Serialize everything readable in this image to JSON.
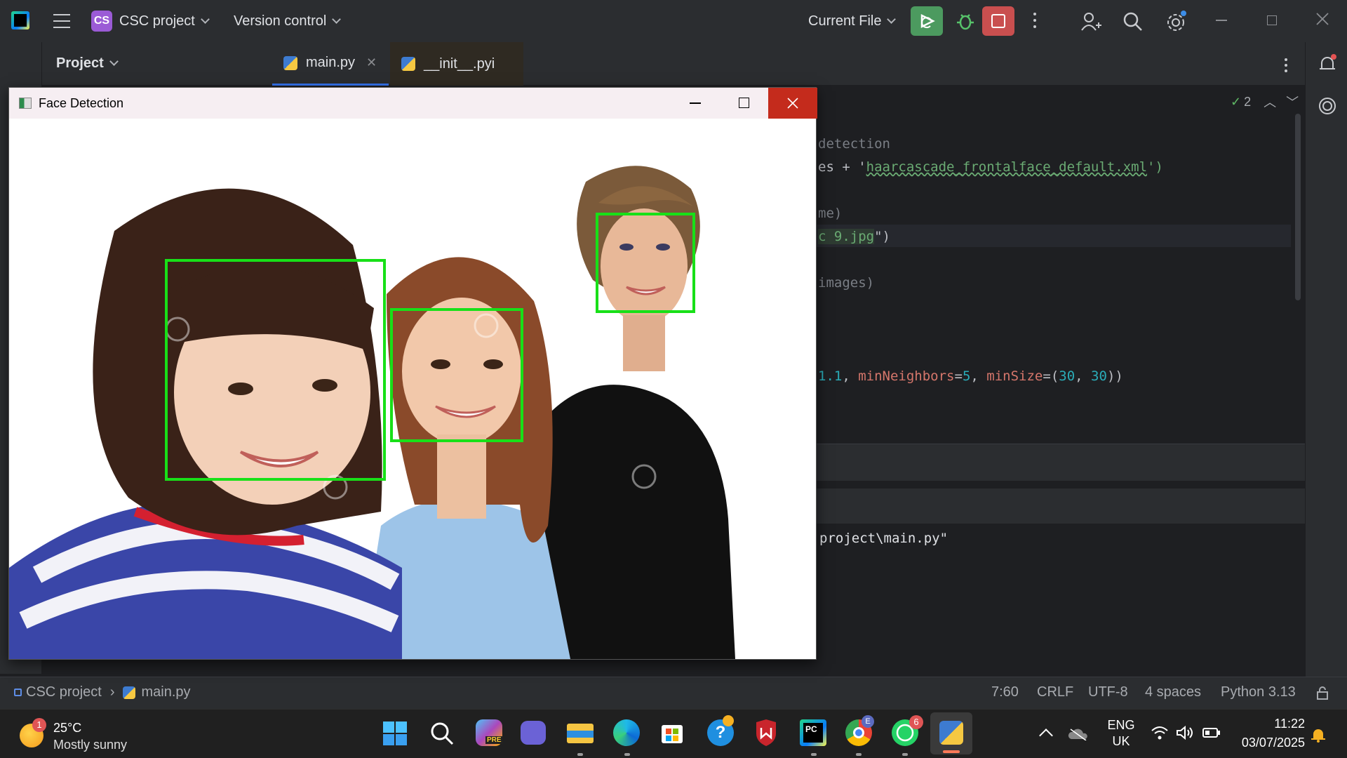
{
  "ide": {
    "project_badge": "CS",
    "project_name": "CSC project",
    "version_control": "Version control",
    "run_config": "Current File",
    "project_panel_label": "Project",
    "tabs": [
      {
        "label": "main.py",
        "closable": true,
        "active": true
      },
      {
        "label": "__init__.pyi",
        "closable": false,
        "active": false
      }
    ],
    "inspection_count": "2",
    "code_lines": [
      {
        "text": "detection",
        "style": "comment"
      },
      {
        "text": "es + 'haarcascade_frontalface_default.xml')",
        "style": "string"
      },
      {
        "text": "me)",
        "style": "comment"
      },
      {
        "text": "c 9.jpg\")",
        "style": "string"
      },
      {
        "text": "images)",
        "style": "comment"
      },
      {
        "text": "1.1, minNeighbors=5, minSize=(30, 30))",
        "style": "params"
      }
    ],
    "code_parts": {
      "line2_pre": "es + '",
      "line2_str": "haarcascade_frontalface_default.xml",
      "line2_post": "')",
      "line4_str": "c 9.jpg",
      "line4_post": "\")",
      "line6_n1": "1.1",
      "line6_c1": ", ",
      "line6_k1": "minNeighbors",
      "line6_eq1": "=",
      "line6_n2": "5",
      "line6_c2": ", ",
      "line6_k2": "minSize",
      "line6_eq2": "=(",
      "line6_n3": "30",
      "line6_c3": ", ",
      "line6_n4": "30",
      "line6_end": "))"
    },
    "terminal_line": "project\\main.py\"",
    "status": {
      "breadcrumb_project": "CSC project",
      "breadcrumb_file": "main.py",
      "position": "7:60",
      "line_sep": "CRLF",
      "encoding": "UTF-8",
      "indent": "4 spaces",
      "interpreter": "Python 3.13"
    }
  },
  "face_window": {
    "title": "Face Detection",
    "detected_faces": 3
  },
  "taskbar": {
    "weather_temp": "25°C",
    "weather_desc": "Mostly sunny",
    "weather_badge": "1",
    "lang_top": "ENG",
    "lang_bottom": "UK",
    "time": "11:22",
    "date": "03/07/2025",
    "chrome_badge": "E",
    "whatsapp_badge": "6",
    "pre_badge": "PRE",
    "pycharm_label": "PC"
  },
  "colors": {
    "ide_bg": "#1e1f22",
    "panel_bg": "#2b2d30",
    "run_green": "#4c9a5f",
    "stop_red": "#c94f4f",
    "face_box": "#18e018",
    "string": "#6aab73",
    "keyword_param": "#d5766b",
    "number": "#2aacb8"
  }
}
